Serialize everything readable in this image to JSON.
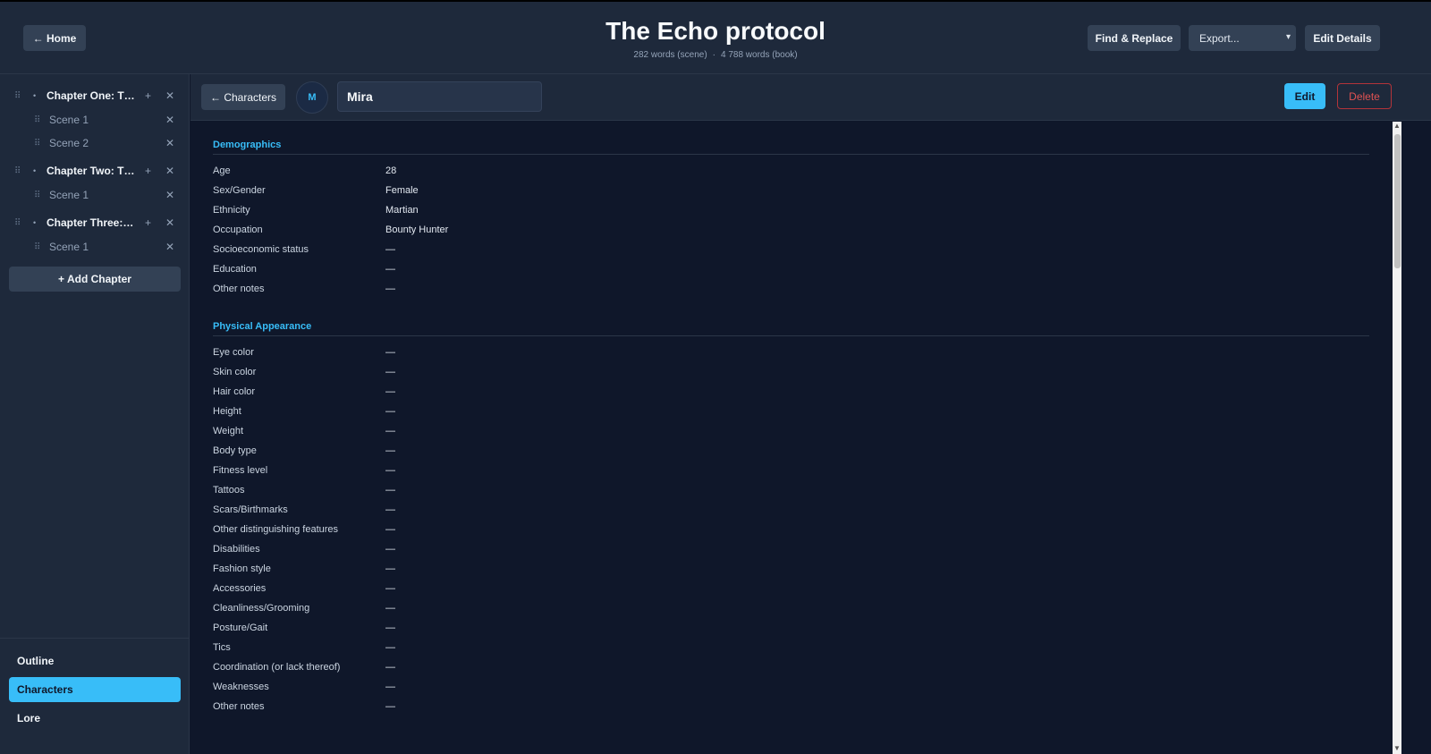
{
  "header": {
    "home_label": "← Home",
    "title": "The Echo protocol",
    "scene_words": "282 words (scene)",
    "separator": "·",
    "book_words": "4 788 words (book)",
    "find_replace_label": "Find & Replace",
    "export_value": "Export...",
    "edit_details_label": "Edit Details"
  },
  "sidebar": {
    "chapters": [
      {
        "title": "Chapter One: Th...",
        "scenes": [
          "Scene 1",
          "Scene 2"
        ]
      },
      {
        "title": "Chapter Two: Th...",
        "scenes": [
          "Scene 1"
        ]
      },
      {
        "title": "Chapter Three: T...",
        "scenes": [
          "Scene 1"
        ]
      }
    ],
    "add_chapter_label": "+ Add Chapter",
    "nav": [
      "Outline",
      "Characters",
      "Lore"
    ],
    "active_nav": "Characters"
  },
  "character": {
    "back_label": "← Characters",
    "avatar_initial": "M",
    "name": "Mira",
    "edit_label": "Edit",
    "delete_label": "Delete"
  },
  "sections": [
    {
      "title": "Demographics",
      "fields": [
        {
          "label": "Age",
          "value": "28"
        },
        {
          "label": "Sex/Gender",
          "value": "Female"
        },
        {
          "label": "Ethnicity",
          "value": "Martian"
        },
        {
          "label": "Occupation",
          "value": "Bounty Hunter"
        },
        {
          "label": "Socioeconomic status",
          "value": "—"
        },
        {
          "label": "Education",
          "value": "—"
        },
        {
          "label": "Other notes",
          "value": "—"
        }
      ]
    },
    {
      "title": "Physical Appearance",
      "fields": [
        {
          "label": "Eye color",
          "value": "—"
        },
        {
          "label": "Skin color",
          "value": "—"
        },
        {
          "label": "Hair color",
          "value": "—"
        },
        {
          "label": "Height",
          "value": "—"
        },
        {
          "label": "Weight",
          "value": "—"
        },
        {
          "label": "Body type",
          "value": "—"
        },
        {
          "label": "Fitness level",
          "value": "—"
        },
        {
          "label": "Tattoos",
          "value": "—"
        },
        {
          "label": "Scars/Birthmarks",
          "value": "—"
        },
        {
          "label": "Other distinguishing features",
          "value": "—"
        },
        {
          "label": "Disabilities",
          "value": "—"
        },
        {
          "label": "Fashion style",
          "value": "—"
        },
        {
          "label": "Accessories",
          "value": "—"
        },
        {
          "label": "Cleanliness/Grooming",
          "value": "—"
        },
        {
          "label": "Posture/Gait",
          "value": "—"
        },
        {
          "label": "Tics",
          "value": "—"
        },
        {
          "label": "Coordination (or lack thereof)",
          "value": "—"
        },
        {
          "label": "Weaknesses",
          "value": "—"
        },
        {
          "label": "Other notes",
          "value": "—"
        }
      ]
    }
  ],
  "icons": {
    "grip": "drag-handle-icon",
    "plus": "plus-icon",
    "close": "close-icon",
    "bullet": "collapse-bullet-icon"
  },
  "colors": {
    "accent": "#38bdf8",
    "danger": "#e05252",
    "background": "#0f172a",
    "panel": "#1e293b"
  }
}
